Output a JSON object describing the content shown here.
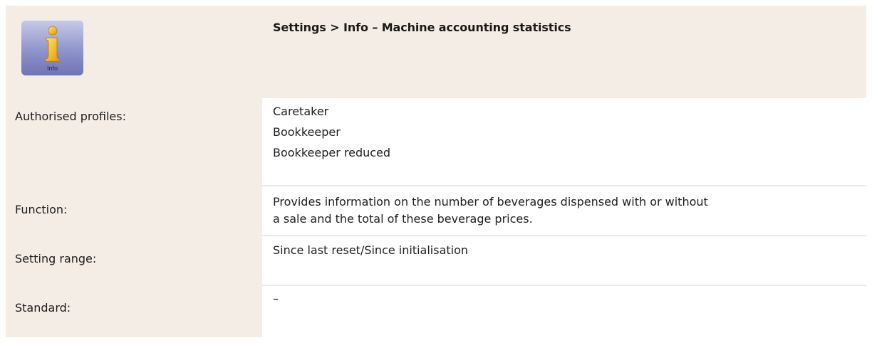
{
  "header": {
    "icon_name": "info-icon",
    "icon_caption": "Info",
    "title": "Settings > Info – Machine accounting statistics"
  },
  "rows": [
    {
      "label": "Authorised profiles:",
      "values": [
        "Caretaker",
        "Bookkeeper",
        "Bookkeeper reduced"
      ]
    },
    {
      "label": "Function:",
      "values": [
        "Provides information on the number of beverages dispensed with or without",
        "a sale and the total of these beverage prices."
      ]
    },
    {
      "label": "Setting range:",
      "values": [
        "Since last reset/Since initialisation"
      ]
    },
    {
      "label": "Standard:",
      "values": [
        "–"
      ]
    }
  ],
  "colors": {
    "panel": "#f4ede5",
    "separator": "#f2e8dd",
    "icon_accent": "#f0b400"
  }
}
